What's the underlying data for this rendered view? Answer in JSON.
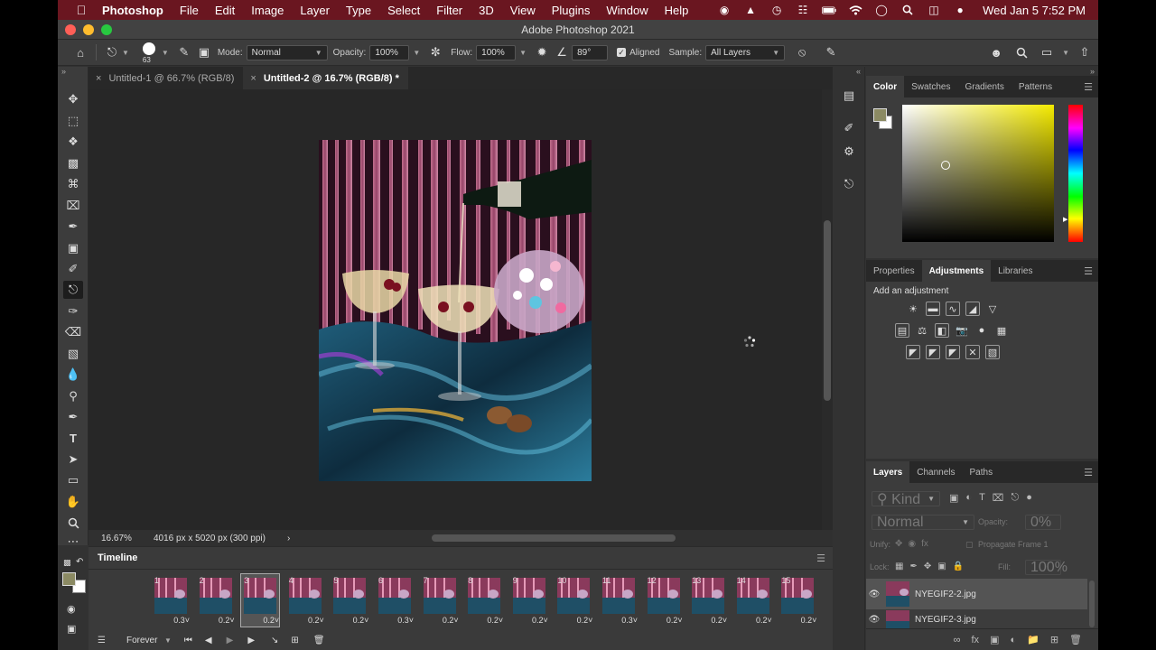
{
  "menubar": {
    "app_name": "Photoshop",
    "items": [
      "File",
      "Edit",
      "Image",
      "Layer",
      "Type",
      "Select",
      "Filter",
      "3D",
      "View",
      "Plugins",
      "Window",
      "Help"
    ],
    "clock": "Wed Jan 5  7:52 PM"
  },
  "window": {
    "title": "Adobe Photoshop 2021"
  },
  "options": {
    "brush_size": "63",
    "mode_label": "Mode:",
    "mode_value": "Normal",
    "opacity_label": "Opacity:",
    "opacity_value": "100%",
    "flow_label": "Flow:",
    "flow_value": "100%",
    "angle_value": "89°",
    "aligned_label": "Aligned",
    "sample_label": "Sample:",
    "sample_value": "All Layers"
  },
  "tabs": [
    {
      "label": "Untitled-1 @ 66.7% (RGB/8)",
      "active": false
    },
    {
      "label": "Untitled-2 @ 16.7% (RGB/8) *",
      "active": true
    }
  ],
  "status": {
    "zoom": "16.67%",
    "doc_info": "4016 px x 5020 px (300 ppi)",
    "arrow": "›"
  },
  "timeline": {
    "title": "Timeline",
    "frames": [
      {
        "n": "1",
        "d": "0.3"
      },
      {
        "n": "2",
        "d": "0.2"
      },
      {
        "n": "3",
        "d": "0.2"
      },
      {
        "n": "4",
        "d": "0.2"
      },
      {
        "n": "5",
        "d": "0.2"
      },
      {
        "n": "6",
        "d": "0.3"
      },
      {
        "n": "7",
        "d": "0.2"
      },
      {
        "n": "8",
        "d": "0.2"
      },
      {
        "n": "9",
        "d": "0.2"
      },
      {
        "n": "10",
        "d": "0.2"
      },
      {
        "n": "11",
        "d": "0.3"
      },
      {
        "n": "12",
        "d": "0.2"
      },
      {
        "n": "13",
        "d": "0.2"
      },
      {
        "n": "14",
        "d": "0.2"
      },
      {
        "n": "15",
        "d": "0.2"
      }
    ],
    "selected_frame": "3",
    "loop": "Forever"
  },
  "color_panel": {
    "tabs": [
      "Color",
      "Swatches",
      "Gradients",
      "Patterns"
    ],
    "fg_color": "#8b8a63"
  },
  "adjust_panel": {
    "tabs": [
      "Properties",
      "Adjustments",
      "Libraries"
    ],
    "add_label": "Add an adjustment"
  },
  "layers_panel": {
    "tabs": [
      "Layers",
      "Channels",
      "Paths"
    ],
    "filter_label": "Kind",
    "blend_value": "Normal",
    "opacity_label": "Opacity:",
    "opacity_value": "0%",
    "unify_label": "Unify:",
    "propagate_label": "Propagate Frame 1",
    "lock_label": "Lock:",
    "fill_label": "Fill:",
    "fill_value": "100%",
    "layers": [
      {
        "name": "NYEGIF2-2.jpg",
        "visible": true
      },
      {
        "name": "NYEGIF2-3.jpg",
        "visible": true
      }
    ]
  }
}
